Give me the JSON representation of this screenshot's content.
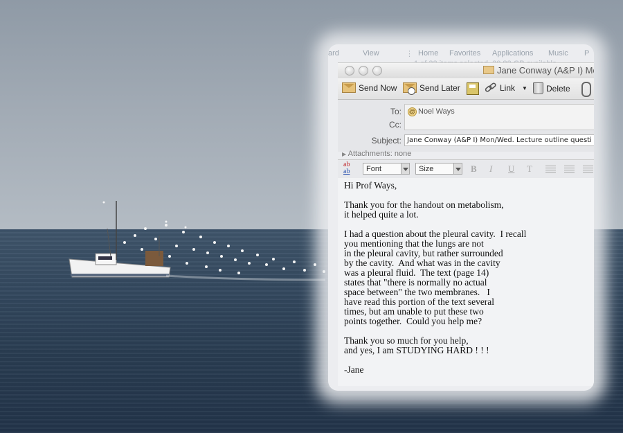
{
  "finder": {
    "items": [
      "ard",
      "View",
      "Home",
      "Favorites",
      "Applications",
      "Music",
      "P"
    ],
    "status": "1 of 33 items selected, 20.82 GB available"
  },
  "window": {
    "title": "Jane Conway (A&P I)  Mo"
  },
  "toolbar": {
    "send_now": "Send Now",
    "send_later": "Send Later",
    "link": "Link",
    "delete": "Delete"
  },
  "headers": {
    "to_label": "To:",
    "to_value": "Noel Ways",
    "cc_label": "Cc:",
    "subject_label": "Subject:",
    "subject_value": "Jane Conway (A&P I)  Mon/Wed. Lecture outline questi",
    "attachments_label": "Attachments:",
    "attachments_value": "none"
  },
  "format": {
    "font_label": "Font",
    "size_label": "Size",
    "bold": "B",
    "italic": "I",
    "underline": "U",
    "strike": "T"
  },
  "message": {
    "lines": [
      "Hi Prof Ways,",
      "",
      "Thank you for the handout on metabolism,",
      "it helped quite a lot.",
      "",
      "I had a question about the pleural cavity.  I recall",
      "you mentioning that the lungs are not",
      "in the pleural cavity, but rather surrounded",
      "by the cavity.  And what was in the cavity",
      "was a pleural fluid.  The text (page 14)",
      "states that \"there is normally no actual",
      "space between\" the two membranes.   I",
      "have read this portion of the text several",
      "times, but am unable to put these two",
      "points together.  Could you help me?",
      "",
      "Thank you so much for you help,",
      "and yes, I am STUDYING HARD ! ! !",
      "",
      "-Jane"
    ]
  }
}
